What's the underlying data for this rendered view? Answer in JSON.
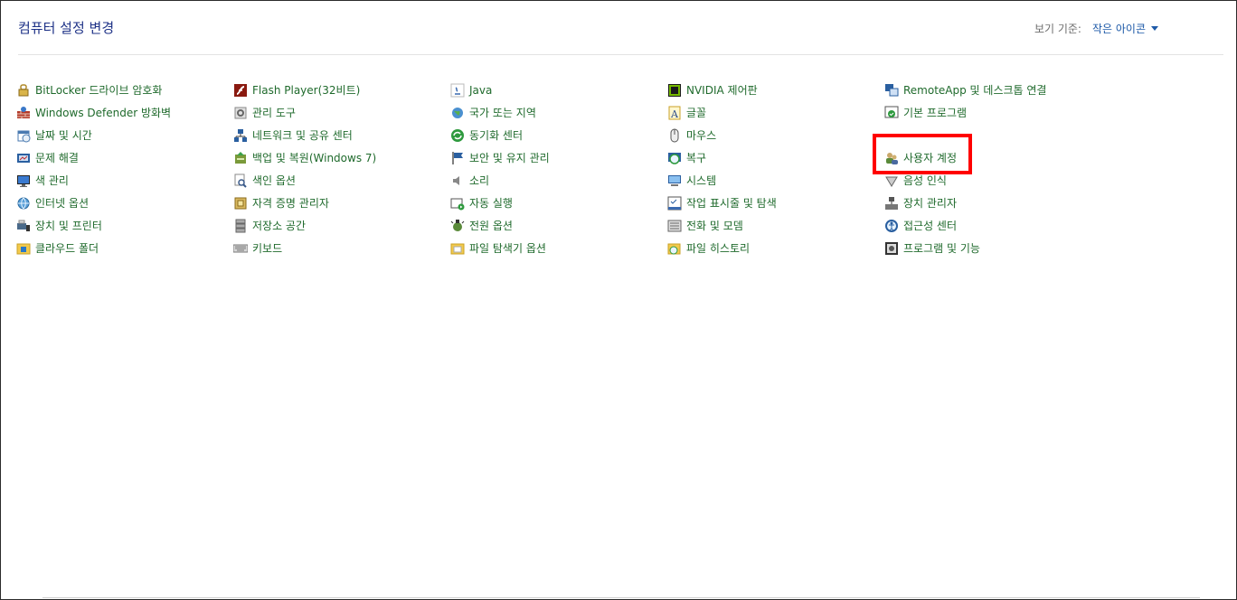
{
  "header": {
    "title": "컴퓨터 설정 변경",
    "view_by_label": "보기 기준:",
    "view_by_value": "작은 아이콘"
  },
  "items": [
    {
      "label": "BitLocker 드라이브 암호화",
      "icon": "bitlocker-icon"
    },
    {
      "label": "Windows Defender 방화벽",
      "icon": "firewall-icon"
    },
    {
      "label": "날짜 및 시간",
      "icon": "datetime-icon"
    },
    {
      "label": "문제 해결",
      "icon": "troubleshoot-icon"
    },
    {
      "label": "색 관리",
      "icon": "color-management-icon"
    },
    {
      "label": "인터넷 옵션",
      "icon": "internet-options-icon"
    },
    {
      "label": "장치 및 프린터",
      "icon": "devices-printers-icon"
    },
    {
      "label": "클라우드 폴더",
      "icon": "cloud-folder-icon"
    },
    {
      "label": "Flash Player(32비트)",
      "icon": "flash-icon"
    },
    {
      "label": "관리 도구",
      "icon": "admin-tools-icon"
    },
    {
      "label": "네트워크 및 공유 센터",
      "icon": "network-icon"
    },
    {
      "label": "백업 및 복원(Windows 7)",
      "icon": "backup-icon"
    },
    {
      "label": "색인 옵션",
      "icon": "indexing-icon"
    },
    {
      "label": "자격 증명 관리자",
      "icon": "credential-icon"
    },
    {
      "label": "저장소 공간",
      "icon": "storage-icon"
    },
    {
      "label": "키보드",
      "icon": "keyboard-icon"
    },
    {
      "label": "Java",
      "icon": "java-icon"
    },
    {
      "label": "국가 또는 지역",
      "icon": "region-icon"
    },
    {
      "label": "동기화 센터",
      "icon": "sync-icon"
    },
    {
      "label": "보안 및 유지 관리",
      "icon": "flag-icon"
    },
    {
      "label": "소리",
      "icon": "sound-icon"
    },
    {
      "label": "자동 실행",
      "icon": "autoplay-icon"
    },
    {
      "label": "전원 옵션",
      "icon": "power-icon"
    },
    {
      "label": "파일 탐색기 옵션",
      "icon": "explorer-options-icon"
    },
    {
      "label": "NVIDIA 제어판",
      "icon": "nvidia-icon"
    },
    {
      "label": "글꼴",
      "icon": "font-icon"
    },
    {
      "label": "마우스",
      "icon": "mouse-icon"
    },
    {
      "label": "복구",
      "icon": "recovery-icon"
    },
    {
      "label": "시스템",
      "icon": "system-icon"
    },
    {
      "label": "작업 표시줄 및 탐색",
      "icon": "taskbar-icon"
    },
    {
      "label": "전화 및 모뎀",
      "icon": "phone-modem-icon"
    },
    {
      "label": "파일 히스토리",
      "icon": "file-history-icon"
    },
    {
      "label": "RemoteApp 및 데스크톱 연결",
      "icon": "remoteapp-icon"
    },
    {
      "label": "기본 프로그램",
      "icon": "default-programs-icon"
    },
    {
      "label": "",
      "icon": "hidden-icon"
    },
    {
      "label": "사용자 계정",
      "icon": "user-accounts-icon"
    },
    {
      "label": "음성 인식",
      "icon": "speech-icon"
    },
    {
      "label": "장치 관리자",
      "icon": "device-manager-icon"
    },
    {
      "label": "접근성 센터",
      "icon": "ease-of-access-icon"
    },
    {
      "label": "프로그램 및 기능",
      "icon": "programs-features-icon"
    }
  ],
  "colors": {
    "title": "#1e3287",
    "link": "#1f6a2c",
    "highlight": "#ff0000"
  }
}
